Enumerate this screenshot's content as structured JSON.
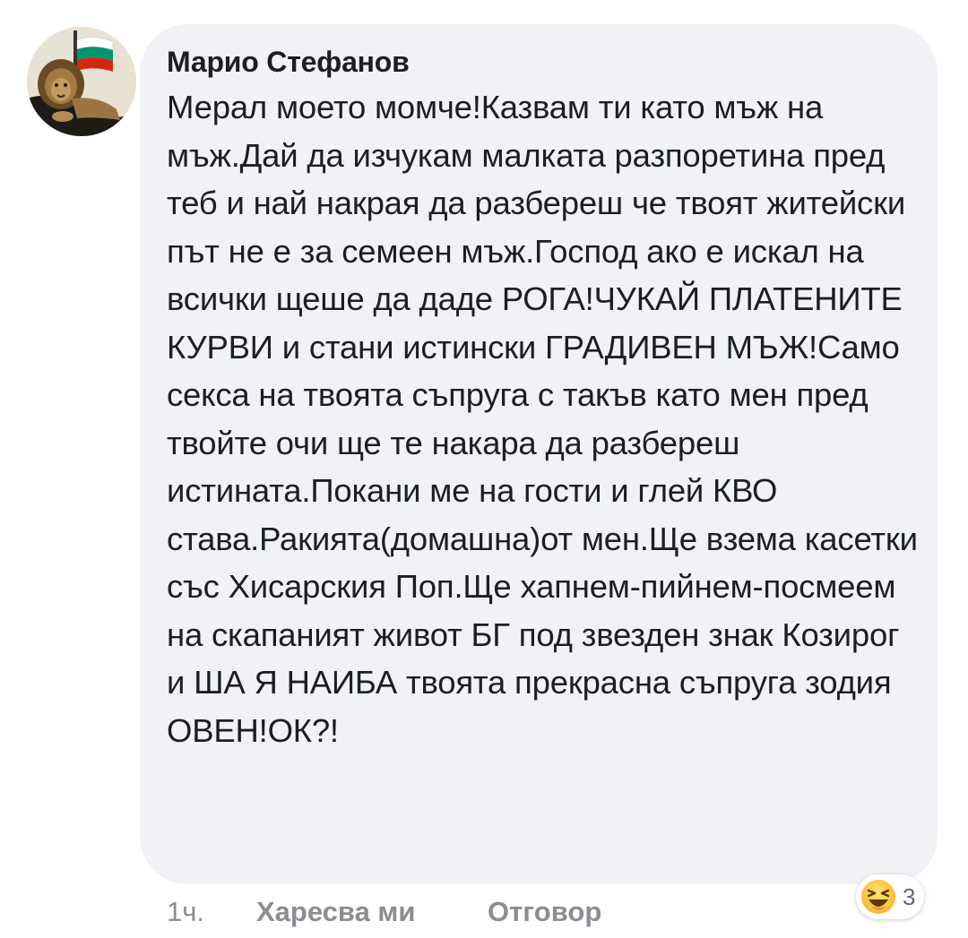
{
  "comment": {
    "author": "Марио Стефанов",
    "text": "Мерал моето момче!Казвам ти като мъж на мъж.Дай да изчукам малката разпоретина пред теб и най накрая да разбереш че твоят житейски път не е за семеен мъж.Господ ако е искал на всички щеше да даде РОГА!ЧУКАЙ ПЛАТЕНИТЕ КУРВИ и стани истински ГРАДИВЕН МЪЖ!Само секса на твоята съпруга с такъв като мен пред твойте очи ще те накара да разбереш истината.Покани ме на гости и глей КВО става.Ракията(домашна)от мен.Ще взема касетки със Хисарския Поп.Ще хапнем-пийнем-посмеем на скапаният живот БГ под звезден знак Козирог и ША Я НАИБА твоята прекрасна съпруга зодия ОВЕН!ОК?!",
    "avatar_icon": "avatar-lion-bulgarian-flag-icon"
  },
  "actions": {
    "time": "1ч.",
    "like_label": "Харесва ми",
    "reply_label": "Отговор"
  },
  "reactions": {
    "icon": "haha-reaction-icon",
    "count": "3"
  },
  "colors": {
    "bubble_bg": "#f0f2f5",
    "text": "#1c1e21",
    "meta": "#8a8d91",
    "flag_white": "#ffffff",
    "flag_green": "#00966e",
    "flag_red": "#d62612"
  }
}
